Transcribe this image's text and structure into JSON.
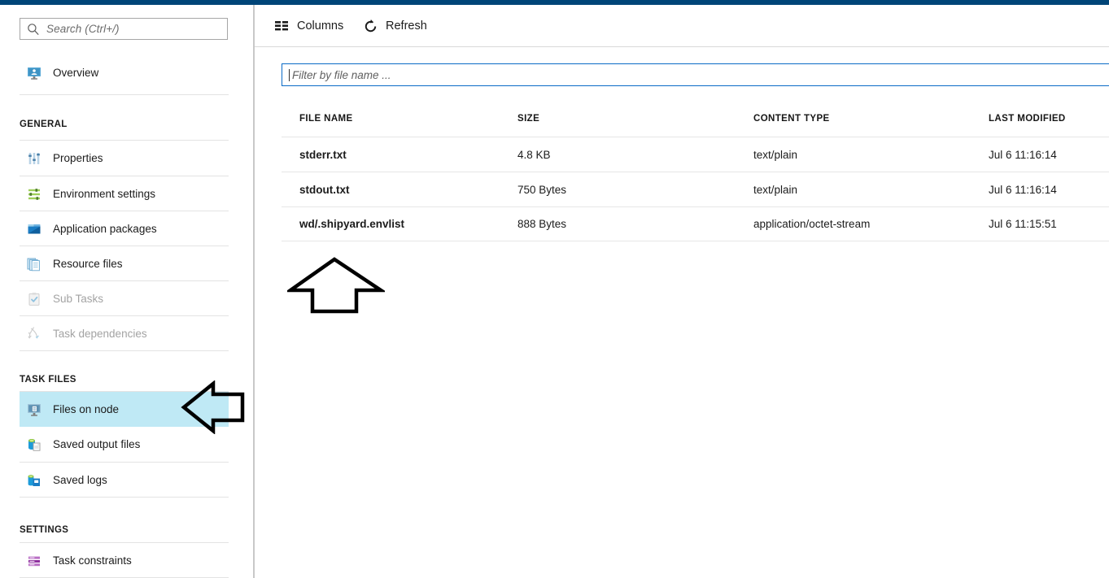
{
  "theme": {
    "top_bar_color": "#004578",
    "selected_item_color": "#bfe9f5",
    "focus_border_color": "#0a6bc6"
  },
  "sidebar": {
    "search": {
      "placeholder": "Search (Ctrl+/)",
      "icon": "search-icon"
    },
    "overview": {
      "label": "Overview",
      "icon": "monitor-icon"
    },
    "groups": [
      {
        "title": "GENERAL",
        "items": [
          {
            "label": "Properties",
            "icon": "sliders-icon",
            "disabled": false
          },
          {
            "label": "Environment settings",
            "icon": "settings-sliders-icon",
            "disabled": false
          },
          {
            "label": "Application packages",
            "icon": "package-box-icon",
            "disabled": false
          },
          {
            "label": "Resource files",
            "icon": "documents-icon",
            "disabled": false
          },
          {
            "label": "Sub Tasks",
            "icon": "clipboard-check-icon",
            "disabled": true
          },
          {
            "label": "Task dependencies",
            "icon": "dependency-graph-icon",
            "disabled": true
          }
        ]
      },
      {
        "title": "TASK FILES",
        "items": [
          {
            "label": "Files on node",
            "icon": "monitor-file-icon",
            "disabled": false,
            "selected": true
          },
          {
            "label": "Saved output files",
            "icon": "storage-file-icon",
            "disabled": false
          },
          {
            "label": "Saved logs",
            "icon": "storage-log-icon",
            "disabled": false
          }
        ]
      },
      {
        "title": "SETTINGS",
        "items": [
          {
            "label": "Task constraints",
            "icon": "constraints-icon",
            "disabled": false
          }
        ]
      }
    ]
  },
  "content": {
    "toolbar": {
      "columns_label": "Columns",
      "columns_icon": "columns-grid-icon",
      "refresh_label": "Refresh",
      "refresh_icon": "refresh-circular-arrow-icon"
    },
    "filter": {
      "placeholder": "Filter by file name ...",
      "value": ""
    },
    "table": {
      "columns": [
        "FILE NAME",
        "SIZE",
        "CONTENT TYPE",
        "LAST MODIFIED"
      ],
      "rows": [
        {
          "file_name": "stderr.txt",
          "size": "4.8 KB",
          "content_type": "text/plain",
          "last_modified": "Jul 6 11:16:14"
        },
        {
          "file_name": "stdout.txt",
          "size": "750 Bytes",
          "content_type": "text/plain",
          "last_modified": "Jul 6 11:16:14"
        },
        {
          "file_name": "wd/.shipyard.envlist",
          "size": "888 Bytes",
          "content_type": "application/octet-stream",
          "last_modified": "Jul 6 11:15:51"
        }
      ]
    }
  },
  "annotations": [
    {
      "name": "up-arrow-annotation",
      "direction": "up"
    },
    {
      "name": "left-arrow-annotation",
      "direction": "left"
    }
  ]
}
